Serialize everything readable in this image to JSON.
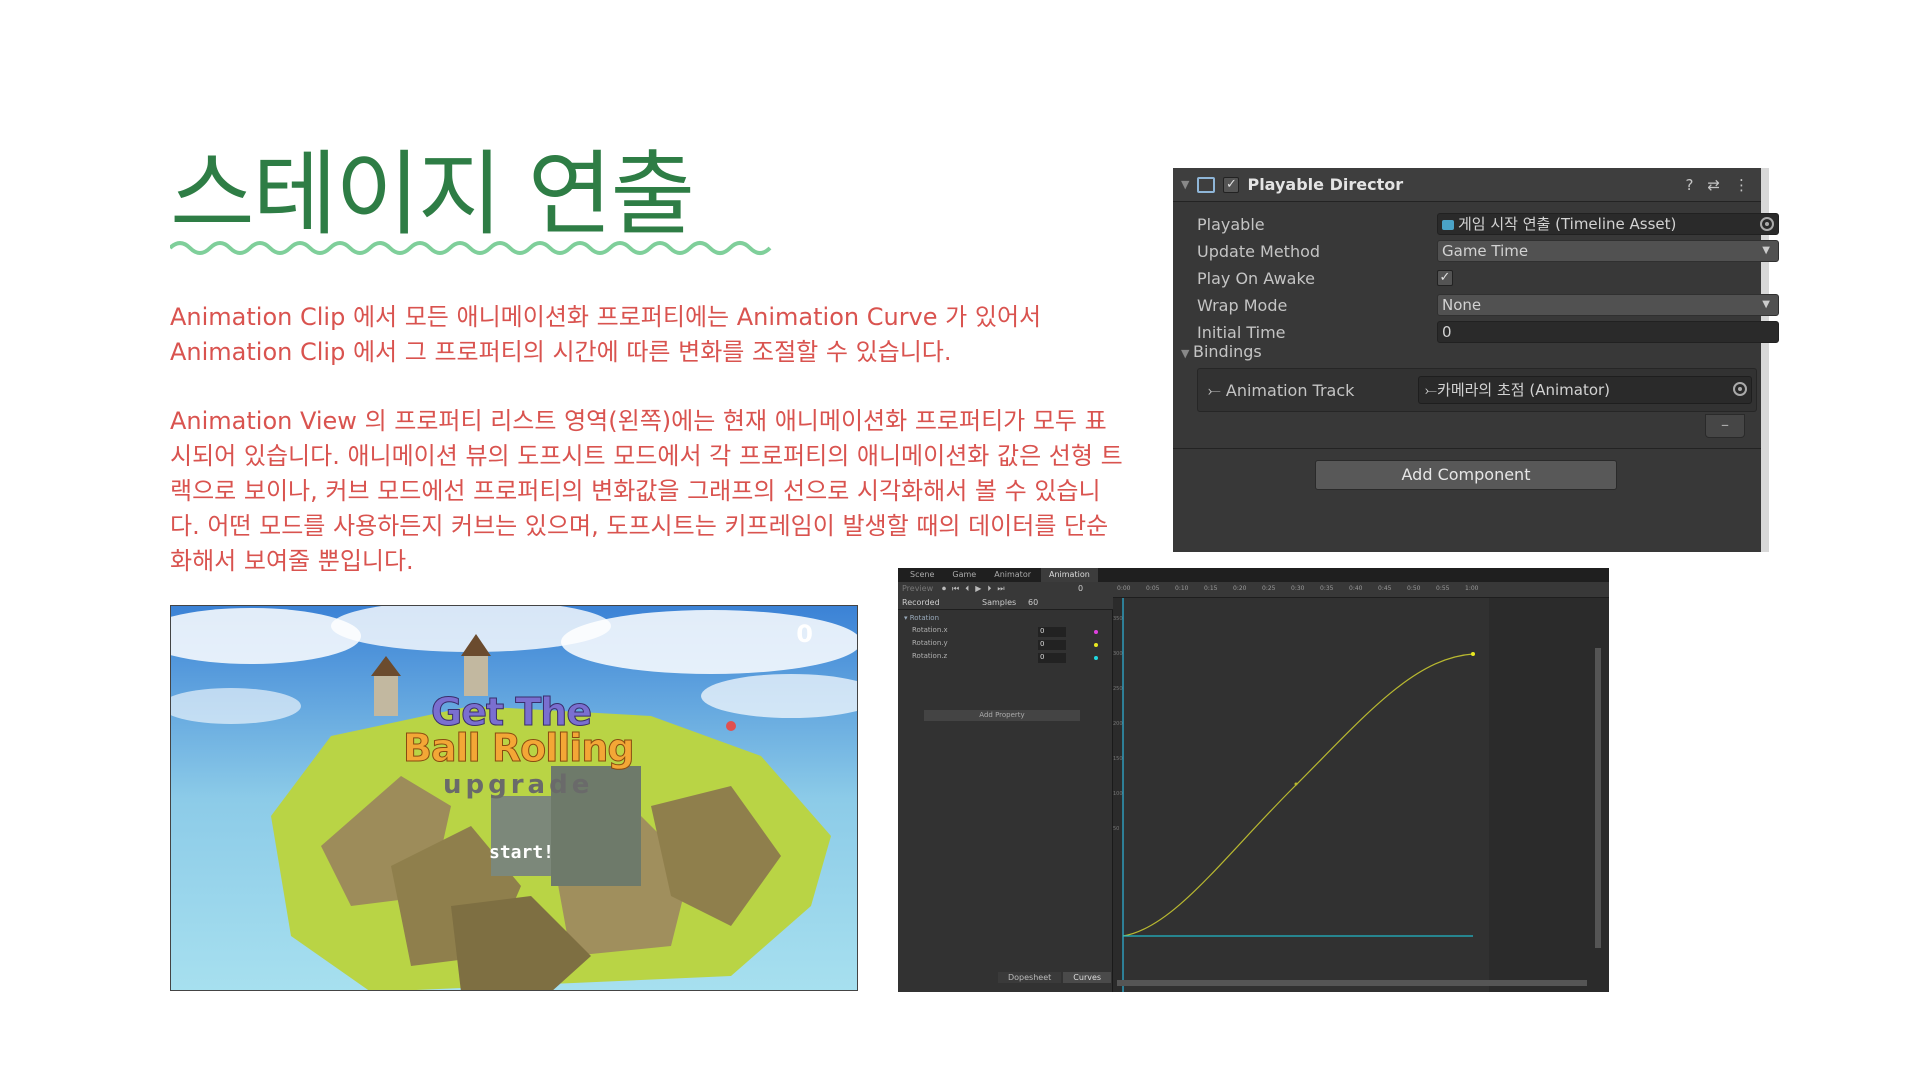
{
  "slide": {
    "title": "스테이지 연출",
    "paragraph1": "Animation Clip 에서 모든 애니메이션화 프로퍼티에는 Animation Curve 가 있어서 Animation Clip 에서 그 프로퍼티의 시간에 따른 변화를 조절할 수 있습니다.",
    "paragraph2": "Animation View 의 프로퍼티 리스트 영역(왼쪽)에는 현재 애니메이션화 프로퍼티가 모두 표시되어 있습니다. 애니메이션 뷰의 도프시트 모드에서 각 프로퍼티의 애니메이션화 값은 선형 트랙으로 보이나, 커브 모드에선 프로퍼티의 변화값을 그래프의 선으로 시각화해서 볼 수 있습니다. 어떤 모드를 사용하든지 커브는 있으며, 도프시트는 키프레임이 발생할 때의 데이터를 단순화해서 보여줄 뿐입니다."
  },
  "inspector": {
    "component_name": "Playable Director",
    "enabled_check": "✓",
    "help_icon": "?",
    "settings_icon": "⇄",
    "menu_icon": "⋮",
    "fields": {
      "playable_label": "Playable",
      "playable_value": "게임 시작 연출 (Timeline Asset)",
      "update_method_label": "Update Method",
      "update_method_value": "Game Time",
      "play_on_awake_label": "Play On Awake",
      "play_on_awake_value": "✓",
      "wrap_mode_label": "Wrap Mode",
      "wrap_mode_value": "None",
      "initial_time_label": "Initial Time",
      "initial_time_value": "0"
    },
    "bindings_label": "Bindings",
    "binding_track": "Animation Track",
    "binding_value": "카메라의 초점 (Animator)",
    "remove_label": "–",
    "add_component": "Add Component"
  },
  "game": {
    "score": "0",
    "title_line1": "Get The",
    "title_line2": "Ball Rolling",
    "subtitle": "upgrade",
    "start": "start!"
  },
  "animation_window": {
    "tabs": [
      "Scene",
      "Game",
      "Animator",
      "Animation"
    ],
    "preview_label": "Preview",
    "playback_icons": "⏺⏮⏴▶⏵⏭",
    "frame_value": "0",
    "clip_label": "Recorded",
    "samples_label": "Samples",
    "samples_value": "60",
    "property_group": "Rotation",
    "properties": [
      {
        "name": "Rotation.x",
        "value": "0",
        "color": "#e040e0"
      },
      {
        "name": "Rotation.y",
        "value": "0",
        "color": "#e8e820"
      },
      {
        "name": "Rotation.z",
        "value": "0",
        "color": "#20d8e0"
      }
    ],
    "add_property": "Add Property",
    "mode_tabs": [
      "Dopesheet",
      "Curves"
    ],
    "ruler_ticks": [
      "0:00",
      "0:05",
      "0:10",
      "0:15",
      "0:20",
      "0:25",
      "0:30",
      "0:35",
      "0:40",
      "0:45",
      "0:50",
      "0:55",
      "1:00"
    ],
    "y_ticks": [
      "350",
      "300",
      "250",
      "200",
      "150",
      "100",
      "50"
    ],
    "curve_color_y": "#b8b830",
    "curve_color_flat": "#20b8c8"
  },
  "colors": {
    "title_green": "#2e7d45",
    "body_red": "#d9534f",
    "wave_green": "#7fcf9a"
  }
}
